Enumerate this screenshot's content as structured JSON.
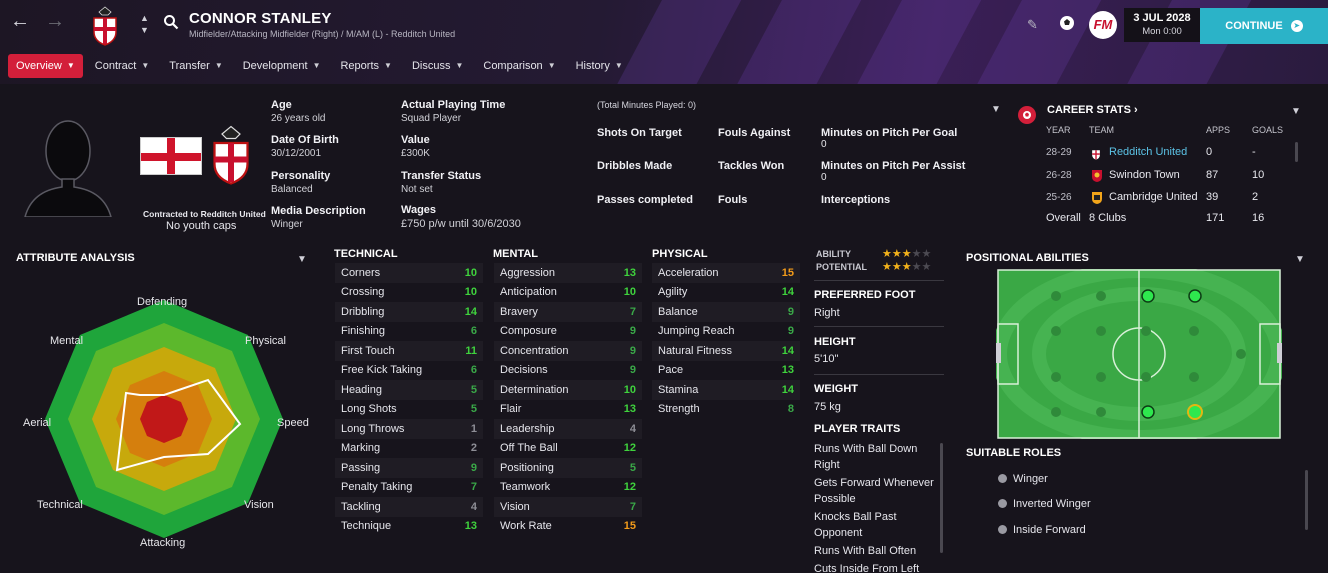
{
  "header": {
    "player_name": "CONNOR STANLEY",
    "player_sub": "Midfielder/Attacking Midfielder (Right) / M/AM (L) - Redditch United",
    "date": "3 JUL 2028",
    "time": "Mon 0:00",
    "continue_label": "CONTINUE",
    "fm_logo": "FM",
    "tabs": [
      {
        "label": "Overview",
        "active": true
      },
      {
        "label": "Contract"
      },
      {
        "label": "Transfer"
      },
      {
        "label": "Development"
      },
      {
        "label": "Reports"
      },
      {
        "label": "Discuss"
      },
      {
        "label": "Comparison"
      },
      {
        "label": "History"
      }
    ]
  },
  "profile": {
    "contracted": "Contracted to Redditch United",
    "youth_caps": "No youth caps",
    "age_label": "Age",
    "age_value": "26 years old",
    "dob_label": "Date Of Birth",
    "dob_value": "30/12/2001",
    "personality_label": "Personality",
    "personality_value": "Balanced",
    "media_label": "Media Description",
    "media_value": "Winger",
    "playing_time_label": "Actual Playing Time",
    "playing_time_value": "Squad Player",
    "value_label": "Value",
    "value_value": "£300K",
    "transfer_label": "Transfer Status",
    "transfer_value": "Not set",
    "wages_label": "Wages",
    "wages_value": "£750 p/w until 30/6/2030"
  },
  "season_stats": {
    "total_minutes": "(Total Minutes Played: 0)",
    "shots_on_target": "Shots On Target",
    "fouls_against": "Fouls Against",
    "min_per_goal": "Minutes on Pitch Per Goal",
    "min_per_goal_value": "0",
    "dribbles": "Dribbles Made",
    "tackles_won": "Tackles Won",
    "min_per_assist": "Minutes on Pitch Per Assist",
    "min_per_assist_value": "0",
    "passes": "Passes completed",
    "fouls": "Fouls",
    "interceptions": "Interceptions"
  },
  "career": {
    "title": "CAREER STATS",
    "headers": {
      "year": "YEAR",
      "team": "TEAM",
      "apps": "APPS",
      "goals": "GOALS"
    },
    "rows": [
      {
        "year": "28-29",
        "team": "Redditch United",
        "apps": "0",
        "goals": "-",
        "link": true
      },
      {
        "year": "26-28",
        "team": "Swindon Town",
        "apps": "87",
        "goals": "10"
      },
      {
        "year": "25-26",
        "team": "Cambridge United",
        "apps": "39",
        "goals": "2"
      },
      {
        "year": "Overall",
        "team": "8 Clubs",
        "apps": "171",
        "goals": "16"
      }
    ]
  },
  "analysis": {
    "title": "ATTRIBUTE ANALYSIS",
    "labels": [
      "Defending",
      "Physical",
      "Speed",
      "Vision",
      "Attacking",
      "Technical",
      "Aerial",
      "Mental"
    ]
  },
  "attributes": {
    "technical_title": "TECHNICAL",
    "mental_title": "MENTAL",
    "physical_title": "PHYSICAL",
    "technical": [
      {
        "name": "Corners",
        "value": 10
      },
      {
        "name": "Crossing",
        "value": 10
      },
      {
        "name": "Dribbling",
        "value": 14
      },
      {
        "name": "Finishing",
        "value": 6
      },
      {
        "name": "First Touch",
        "value": 11
      },
      {
        "name": "Free Kick Taking",
        "value": 6
      },
      {
        "name": "Heading",
        "value": 5
      },
      {
        "name": "Long Shots",
        "value": 5
      },
      {
        "name": "Long Throws",
        "value": 1
      },
      {
        "name": "Marking",
        "value": 2
      },
      {
        "name": "Passing",
        "value": 9
      },
      {
        "name": "Penalty Taking",
        "value": 7
      },
      {
        "name": "Tackling",
        "value": 4
      },
      {
        "name": "Technique",
        "value": 13
      }
    ],
    "mental": [
      {
        "name": "Aggression",
        "value": 13
      },
      {
        "name": "Anticipation",
        "value": 10
      },
      {
        "name": "Bravery",
        "value": 7
      },
      {
        "name": "Composure",
        "value": 9
      },
      {
        "name": "Concentration",
        "value": 9
      },
      {
        "name": "Decisions",
        "value": 9
      },
      {
        "name": "Determination",
        "value": 10
      },
      {
        "name": "Flair",
        "value": 13
      },
      {
        "name": "Leadership",
        "value": 4
      },
      {
        "name": "Off The Ball",
        "value": 12
      },
      {
        "name": "Positioning",
        "value": 5
      },
      {
        "name": "Teamwork",
        "value": 12
      },
      {
        "name": "Vision",
        "value": 7
      },
      {
        "name": "Work Rate",
        "value": 15
      }
    ],
    "physical": [
      {
        "name": "Acceleration",
        "value": 15
      },
      {
        "name": "Agility",
        "value": 14
      },
      {
        "name": "Balance",
        "value": 9
      },
      {
        "name": "Jumping Reach",
        "value": 9
      },
      {
        "name": "Natural Fitness",
        "value": 14
      },
      {
        "name": "Pace",
        "value": 13
      },
      {
        "name": "Stamina",
        "value": 14
      },
      {
        "name": "Strength",
        "value": 8
      }
    ]
  },
  "details": {
    "ability_label": "ABILITY",
    "ability_stars": 3,
    "potential_label": "POTENTIAL",
    "potential_stars": 3,
    "foot_label": "PREFERRED FOOT",
    "foot_value": "Right",
    "height_label": "HEIGHT",
    "height_value": "5'10\"",
    "weight_label": "WEIGHT",
    "weight_value": "75 kg",
    "traits_label": "PLAYER TRAITS",
    "traits": [
      "Runs With Ball Down Right",
      "Gets Forward Whenever Possible",
      "Knocks Ball Past Opponent",
      "Runs With Ball Often",
      "Cuts Inside From Left"
    ]
  },
  "positional": {
    "title": "POSITIONAL ABILITIES",
    "roles_title": "SUITABLE ROLES",
    "roles": [
      "Winger",
      "Inverted Winger",
      "Inside Forward"
    ]
  },
  "colors": {
    "accent_red": "#d31f3a",
    "continue": "#2bb3c8",
    "attr_high": "#3fd23d",
    "attr_mid": "#3aa848",
    "attr_low": "#8e8e96",
    "attr_top": "#f29b1a",
    "pitch": "#3aa845"
  }
}
